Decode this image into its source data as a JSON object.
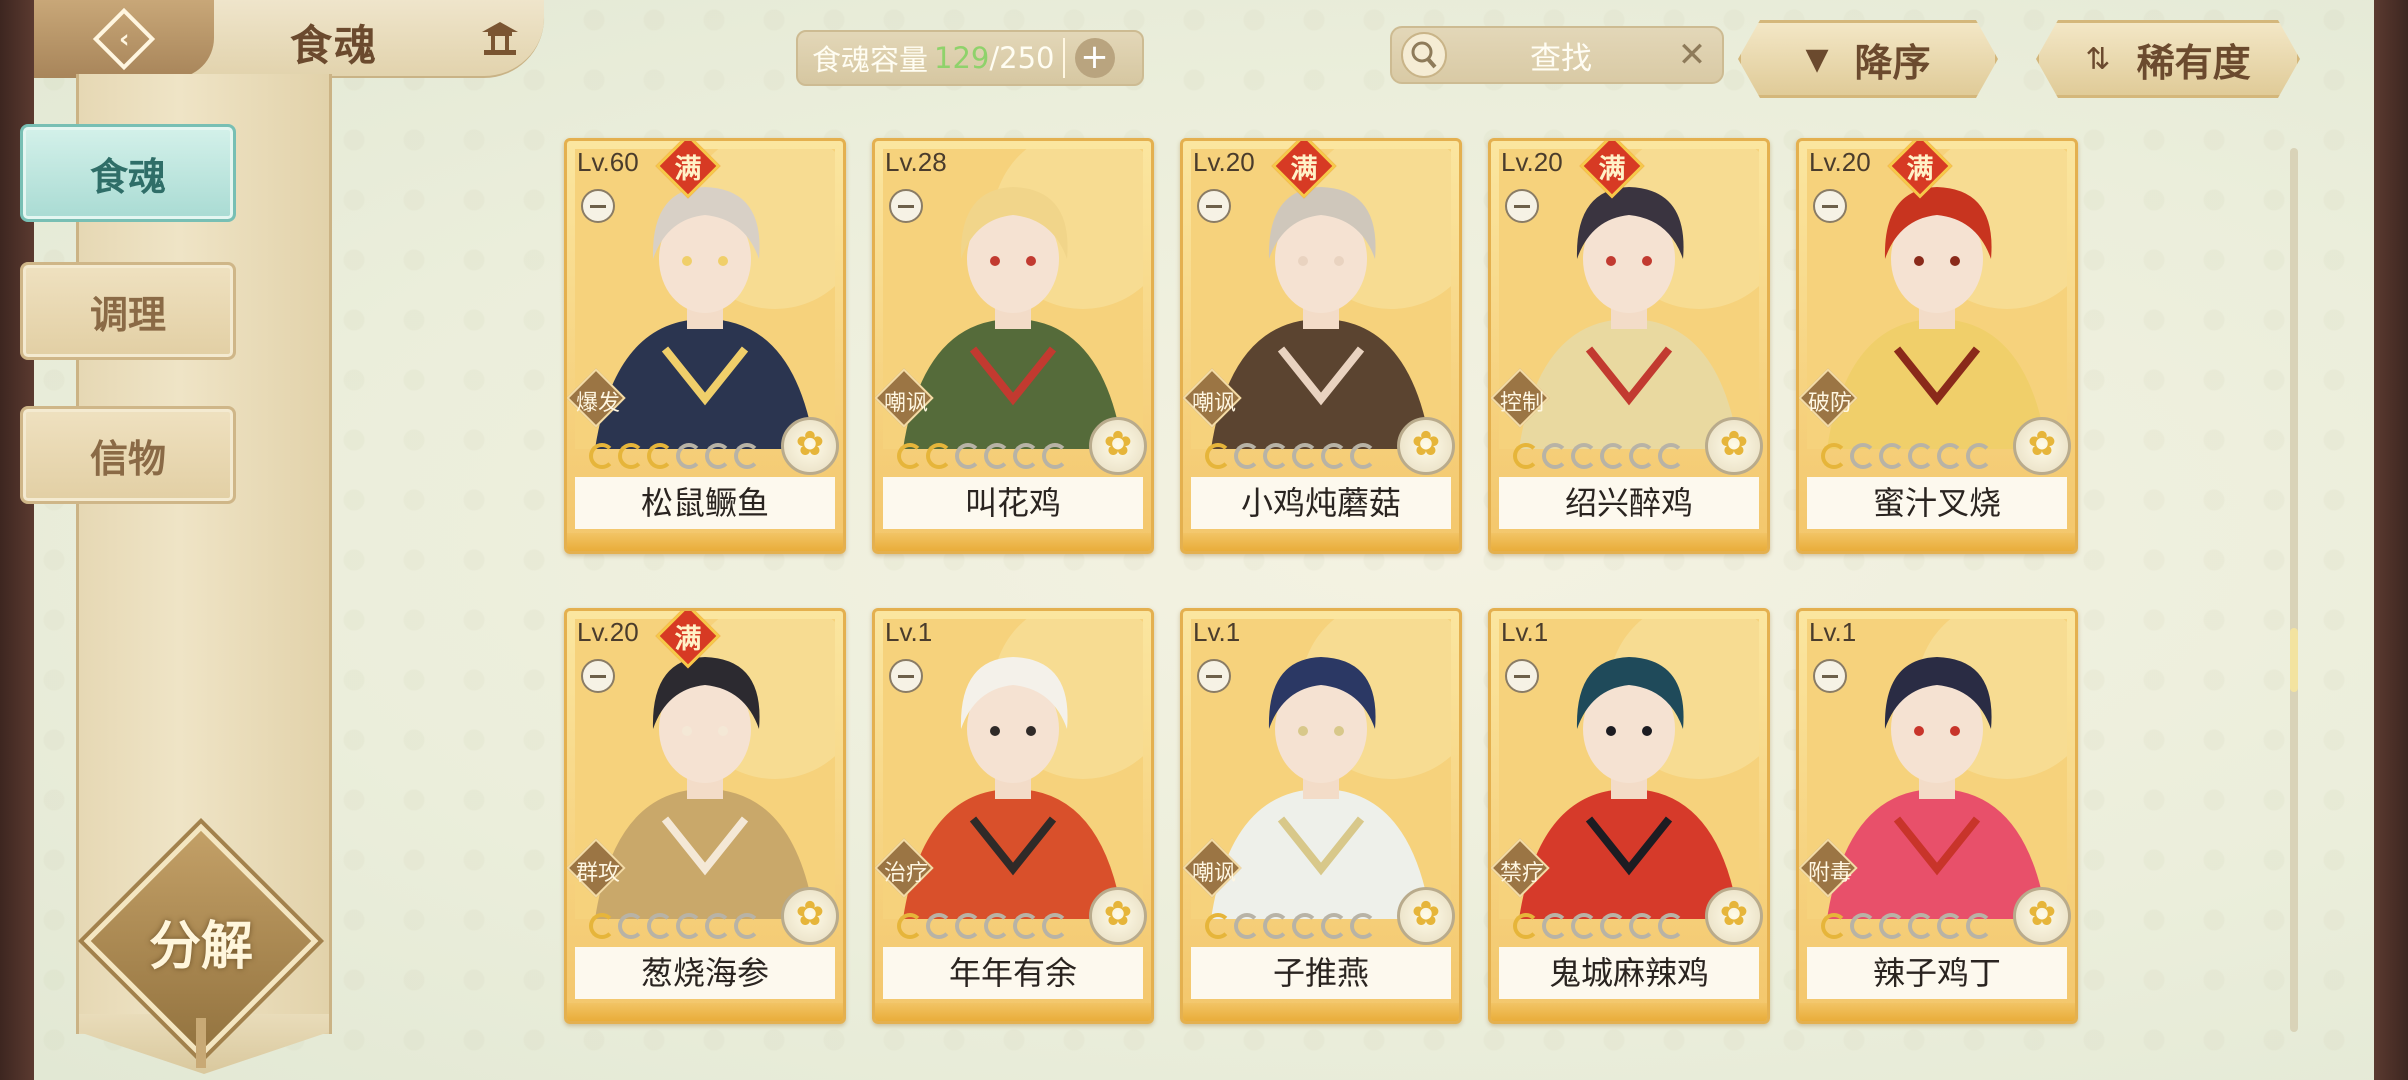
{
  "header": {
    "title": "食魂",
    "capacity": {
      "label": "食魂容量",
      "current": "129",
      "total": "/250"
    },
    "search": {
      "placeholder": "查找"
    },
    "sort_order": "降序",
    "sort_by": "稀有度"
  },
  "sidebar": {
    "items": [
      {
        "label": "食魂",
        "active": true
      },
      {
        "label": "调理",
        "active": false
      },
      {
        "label": "信物",
        "active": false
      }
    ],
    "decompose_label": "分解"
  },
  "colors": {
    "accent_teal": "#a9dbd3",
    "card_gold": "#f3c66b",
    "full_badge_red": "#d73a24",
    "capacity_green": "#8fd26b"
  },
  "cards": [
    {
      "level": "Lv.60",
      "full": "满",
      "role": "爆发",
      "stars": 3,
      "name": "松鼠鳜鱼",
      "palette": [
        "#d8d0c6",
        "#2b3550",
        "#f0cf6a"
      ]
    },
    {
      "level": "Lv.28",
      "full": "",
      "role": "嘲讽",
      "stars": 2,
      "name": "叫花鸡",
      "palette": [
        "#f1d58a",
        "#556b3a",
        "#c23a30"
      ]
    },
    {
      "level": "Lv.20",
      "full": "满",
      "role": "嘲讽",
      "stars": 1,
      "name": "小鸡炖蘑菇",
      "palette": [
        "#cfc7bb",
        "#5b4430",
        "#e9d3c0"
      ]
    },
    {
      "level": "Lv.20",
      "full": "满",
      "role": "控制",
      "stars": 1,
      "name": "绍兴醉鸡",
      "palette": [
        "#3a3440",
        "#e9d9a0",
        "#c23a30"
      ]
    },
    {
      "level": "Lv.20",
      "full": "满",
      "role": "破防",
      "stars": 1,
      "name": "蜜汁叉烧",
      "palette": [
        "#c8341f",
        "#f0cf6a",
        "#8a2a1a"
      ]
    },
    {
      "level": "Lv.20",
      "full": "满",
      "role": "群攻",
      "stars": 1,
      "name": "葱烧海参",
      "palette": [
        "#2c2a30",
        "#c9a86a",
        "#f4e8d6"
      ]
    },
    {
      "level": "Lv.1",
      "full": "",
      "role": "治疗",
      "stars": 1,
      "name": "年年有余",
      "palette": [
        "#f4f1ea",
        "#d9502b",
        "#2f2a28"
      ]
    },
    {
      "level": "Lv.1",
      "full": "",
      "role": "嘲讽",
      "stars": 1,
      "name": "子推燕",
      "palette": [
        "#2b3864",
        "#eef0ea",
        "#d8c88a"
      ]
    },
    {
      "level": "Lv.1",
      "full": "",
      "role": "禁疗",
      "stars": 1,
      "name": "鬼城麻辣鸡",
      "palette": [
        "#1f4a5a",
        "#d63a2a",
        "#1c1c22"
      ]
    },
    {
      "level": "Lv.1",
      "full": "",
      "role": "附毒",
      "stars": 1,
      "name": "辣子鸡丁",
      "palette": [
        "#2a2c44",
        "#e8506a",
        "#c8342a"
      ]
    }
  ]
}
